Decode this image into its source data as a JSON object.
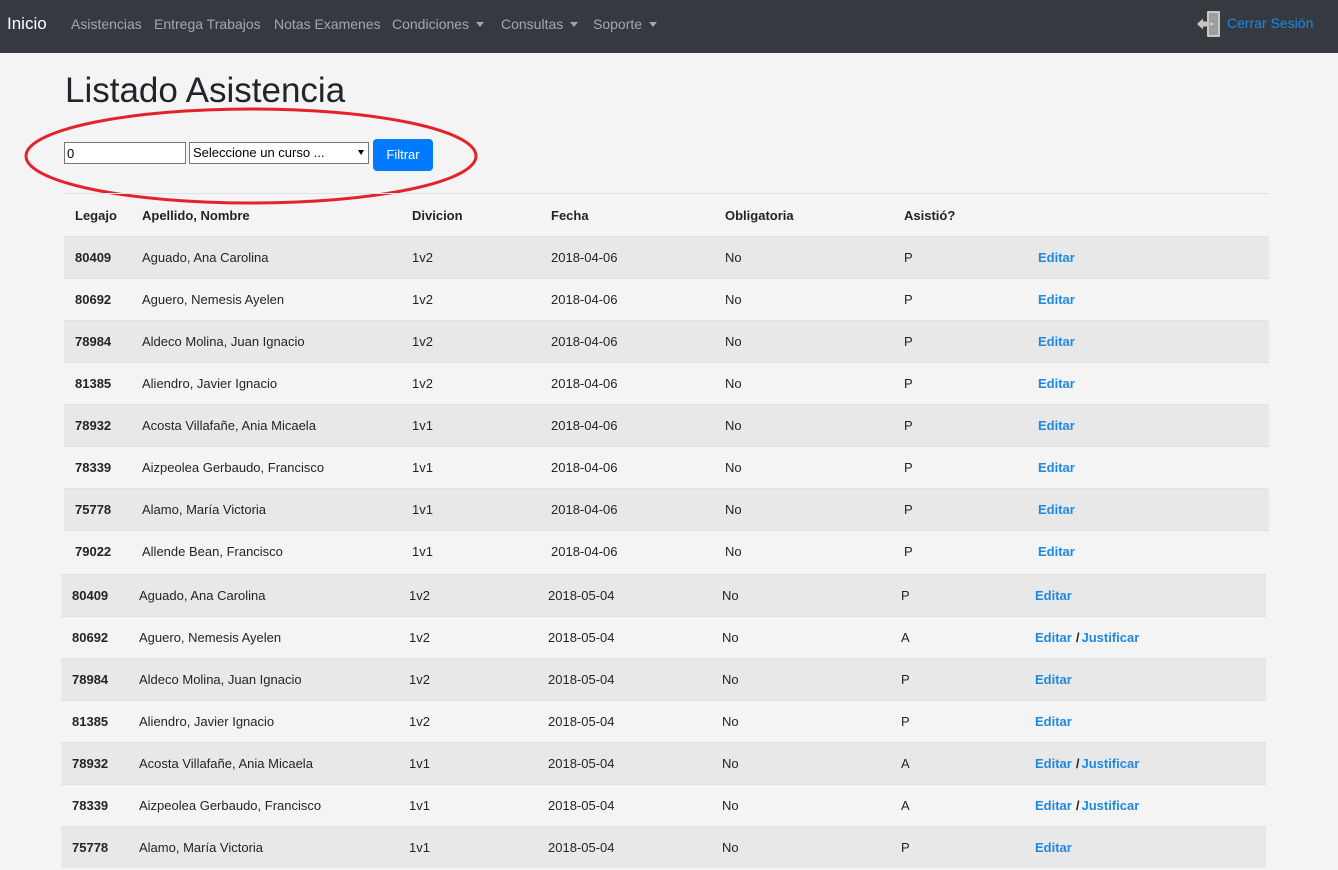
{
  "navbar": {
    "brand": "Inicio",
    "links": [
      "Asistencias",
      "Entrega Trabajos",
      "Notas Examenes"
    ],
    "dropdowns": [
      "Condiciones",
      "Consultas",
      "Soporte"
    ],
    "logout_label": "Cerrar Sesión"
  },
  "page": {
    "title": "Listado Asistencia"
  },
  "filter": {
    "input_value": "0",
    "select_value": "Seleccione un curso ...",
    "button_label": "Filtrar"
  },
  "table": {
    "headers": [
      "Legajo",
      "Apellido, Nombre",
      "Divicion",
      "Fecha",
      "Obligatoria",
      "Asistió?"
    ],
    "edit_label": "Editar",
    "justify_label": "Justificar",
    "separator": "/",
    "rows": [
      {
        "legajo": "80409",
        "nombre": "Aguado, Ana Carolina",
        "division": "1v2",
        "fecha": "2018-04-06",
        "obligatoria": "No",
        "asistio": "P",
        "justificar": false
      },
      {
        "legajo": "80692",
        "nombre": "Aguero, Nemesis Ayelen",
        "division": "1v2",
        "fecha": "2018-04-06",
        "obligatoria": "No",
        "asistio": "P",
        "justificar": false
      },
      {
        "legajo": "78984",
        "nombre": "Aldeco Molina, Juan Ignacio",
        "division": "1v2",
        "fecha": "2018-04-06",
        "obligatoria": "No",
        "asistio": "P",
        "justificar": false
      },
      {
        "legajo": "81385",
        "nombre": "Aliendro, Javier Ignacio",
        "division": "1v2",
        "fecha": "2018-04-06",
        "obligatoria": "No",
        "asistio": "P",
        "justificar": false
      },
      {
        "legajo": "78932",
        "nombre": "Acosta Villafañe, Ania Micaela",
        "division": "1v1",
        "fecha": "2018-04-06",
        "obligatoria": "No",
        "asistio": "P",
        "justificar": false
      },
      {
        "legajo": "78339",
        "nombre": "Aizpeolea Gerbaudo, Francisco",
        "division": "1v1",
        "fecha": "2018-04-06",
        "obligatoria": "No",
        "asistio": "P",
        "justificar": false
      },
      {
        "legajo": "75778",
        "nombre": "Alamo, María Victoria",
        "division": "1v1",
        "fecha": "2018-04-06",
        "obligatoria": "No",
        "asistio": "P",
        "justificar": false
      },
      {
        "legajo": "79022",
        "nombre": "Allende Bean, Francisco",
        "division": "1v1",
        "fecha": "2018-04-06",
        "obligatoria": "No",
        "asistio": "P",
        "justificar": false
      },
      {
        "legajo": "80409",
        "nombre": "Aguado, Ana Carolina",
        "division": "1v2",
        "fecha": "2018-05-04",
        "obligatoria": "No",
        "asistio": "P",
        "justificar": false
      },
      {
        "legajo": "80692",
        "nombre": "Aguero, Nemesis Ayelen",
        "division": "1v2",
        "fecha": "2018-05-04",
        "obligatoria": "No",
        "asistio": "A",
        "justificar": true
      },
      {
        "legajo": "78984",
        "nombre": "Aldeco Molina, Juan Ignacio",
        "division": "1v2",
        "fecha": "2018-05-04",
        "obligatoria": "No",
        "asistio": "P",
        "justificar": false
      },
      {
        "legajo": "81385",
        "nombre": "Aliendro, Javier Ignacio",
        "division": "1v2",
        "fecha": "2018-05-04",
        "obligatoria": "No",
        "asistio": "P",
        "justificar": false
      },
      {
        "legajo": "78932",
        "nombre": "Acosta Villafañe, Ania Micaela",
        "division": "1v1",
        "fecha": "2018-05-04",
        "obligatoria": "No",
        "asistio": "A",
        "justificar": true
      },
      {
        "legajo": "78339",
        "nombre": "Aizpeolea Gerbaudo, Francisco",
        "division": "1v1",
        "fecha": "2018-05-04",
        "obligatoria": "No",
        "asistio": "A",
        "justificar": true
      },
      {
        "legajo": "75778",
        "nombre": "Alamo, María Victoria",
        "division": "1v1",
        "fecha": "2018-05-04",
        "obligatoria": "No",
        "asistio": "P",
        "justificar": false
      }
    ]
  },
  "colors": {
    "navbar_bg": "#343a40",
    "link": "#1e88e5",
    "primary_button": "#007bff",
    "annotation": "#e3222b"
  }
}
